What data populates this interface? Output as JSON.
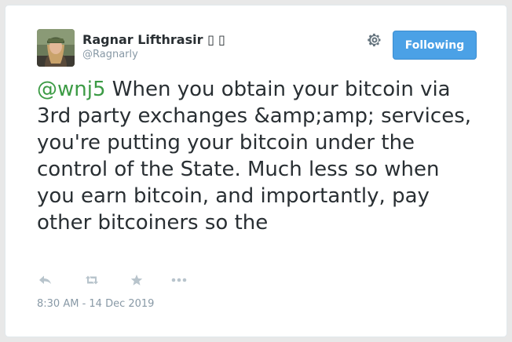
{
  "author": {
    "name": "Ragnar Lifthrasir",
    "name_suffix_glyphs": "▯ ▯",
    "handle": "@Ragnarly",
    "avatar_icon": "profile-photo"
  },
  "follow_button": {
    "label": "Following",
    "color": "#4ba1e6"
  },
  "settings_icon": "gear-icon",
  "tweet": {
    "mention": "@wnj5",
    "text": " When you obtain your bitcoin via 3rd party exchanges &amp;amp; services, you're putting your bitcoin under the control of the State. Much less so when you earn bitcoin, and importantly, pay other bitcoiners so the",
    "mention_color": "#3c9b45"
  },
  "actions": [
    {
      "icon": "reply-icon"
    },
    {
      "icon": "retweet-icon"
    },
    {
      "icon": "favorite-star-icon"
    },
    {
      "icon": "more-icon"
    }
  ],
  "timestamp": "8:30 AM - 14 Dec 2019"
}
